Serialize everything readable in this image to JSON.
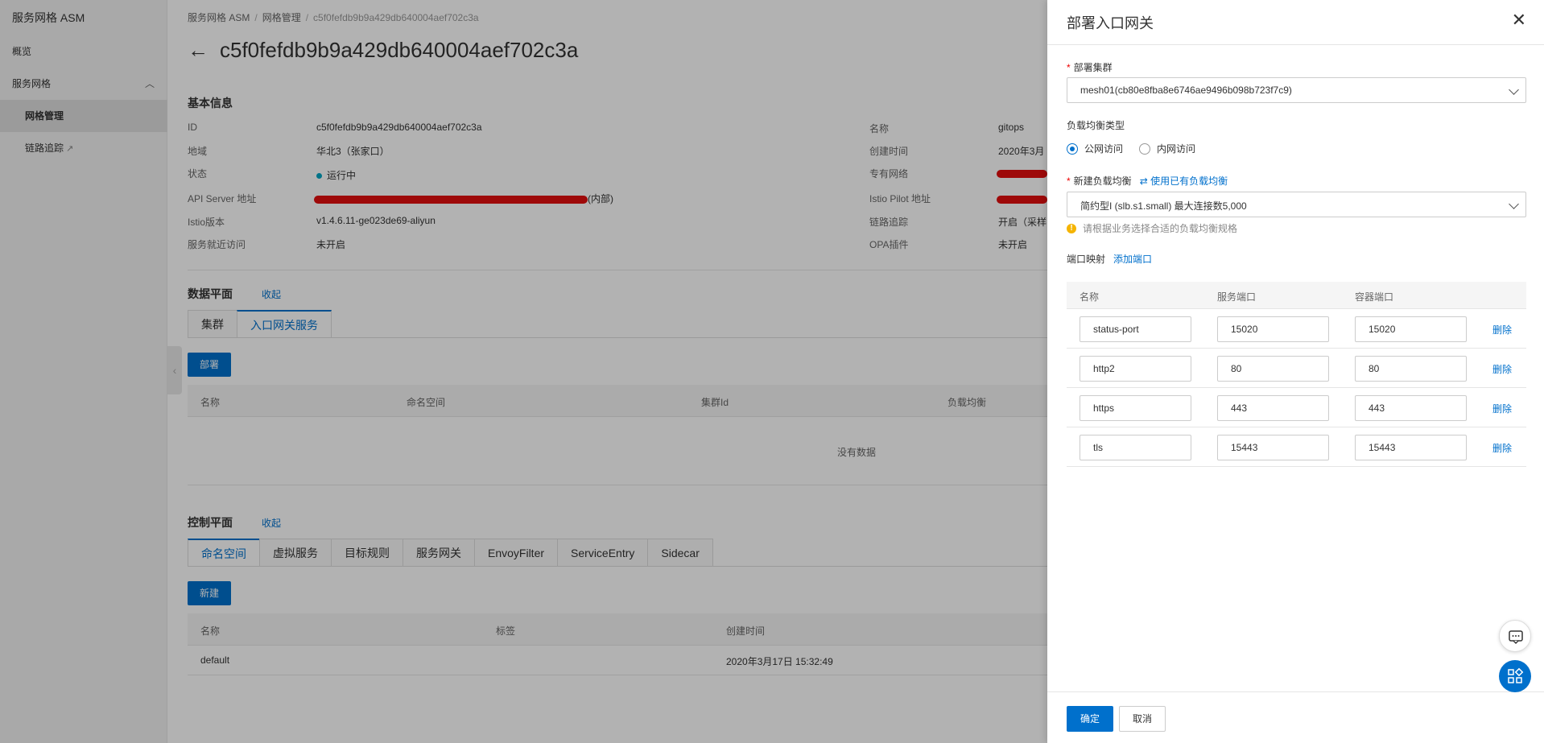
{
  "sidebar": {
    "brand": "服务网格 ASM",
    "items": [
      {
        "label": "概览"
      },
      {
        "label": "服务网格"
      },
      {
        "label": "网格管理"
      },
      {
        "label": "链路追踪"
      }
    ]
  },
  "breadcrumb": [
    "服务网格 ASM",
    "网格管理",
    "c5f0fefdb9b9a429db640004aef702c3a"
  ],
  "page_title": "c5f0fefdb9b9a429db640004aef702c3a",
  "basic_info": {
    "heading": "基本信息",
    "left": [
      {
        "key": "ID",
        "value": "c5f0fefdb9b9a429db640004aef702c3a"
      },
      {
        "key": "地域",
        "value": "华北3（张家口）"
      },
      {
        "key": "状态",
        "value": "运行中"
      },
      {
        "key": "API Server 地址",
        "value": "(内部)"
      },
      {
        "key": "Istio版本",
        "value": "v1.4.6.11-ge023de69-aliyun"
      },
      {
        "key": "服务就近访问",
        "value": "未开启"
      }
    ],
    "right": [
      {
        "key": "名称",
        "value": "gitops"
      },
      {
        "key": "创建时间",
        "value": "2020年3月"
      },
      {
        "key": "专有网络",
        "value": ""
      },
      {
        "key": "Istio Pilot 地址",
        "value": ""
      },
      {
        "key": "链路追踪",
        "value": "开启（采样"
      },
      {
        "key": "OPA插件",
        "value": "未开启"
      }
    ]
  },
  "data_plane": {
    "heading": "数据平面",
    "collapse": "收起",
    "tabs": [
      "集群",
      "入口网关服务"
    ],
    "deploy_button": "部署",
    "columns": [
      "名称",
      "命名空间",
      "集群Id",
      "负载均衡"
    ],
    "empty_text": "没有数据"
  },
  "control_plane": {
    "heading": "控制平面",
    "collapse": "收起",
    "tabs": [
      "命名空间",
      "虚拟服务",
      "目标规则",
      "服务网关",
      "EnvoyFilter",
      "ServiceEntry",
      "Sidecar"
    ],
    "new_button": "新建",
    "columns": [
      "名称",
      "标签",
      "创建时间"
    ],
    "rows": [
      {
        "name": "default",
        "labels": "",
        "created": "2020年3月17日 15:32:49"
      }
    ]
  },
  "drawer": {
    "title": "部署入口网关",
    "cluster_label": "部署集群",
    "cluster_value": "mesh01(cb80e8fba8e6746ae9496b098b723f7c9)",
    "lb_type_label": "负载均衡类型",
    "lb_type_options": [
      {
        "label": "公网访问",
        "selected": true
      },
      {
        "label": "内网访问",
        "selected": false
      }
    ],
    "new_lb_label": "新建负载均衡",
    "use_existing_link": "使用已有负载均衡",
    "lb_spec_value": "简约型I (slb.s1.small) 最大连接数5,000",
    "lb_hint": "请根据业务选择合适的负载均衡规格",
    "port_mapping_label": "端口映射",
    "add_port_link": "添加端口",
    "port_columns": [
      "名称",
      "服务端口",
      "容器端口"
    ],
    "ports": [
      {
        "name": "status-port",
        "service_port": "15020",
        "container_port": "15020",
        "action": "删除"
      },
      {
        "name": "http2",
        "service_port": "80",
        "container_port": "80",
        "action": "删除"
      },
      {
        "name": "https",
        "service_port": "443",
        "container_port": "443",
        "action": "删除"
      },
      {
        "name": "tls",
        "service_port": "15443",
        "container_port": "15443",
        "action": "删除"
      }
    ],
    "confirm_button": "确定",
    "cancel_button": "取消"
  },
  "colors": {
    "accent": "#0070cc",
    "status_running": "#00a5c3",
    "required": "#e00000",
    "warning": "#f5b400"
  }
}
